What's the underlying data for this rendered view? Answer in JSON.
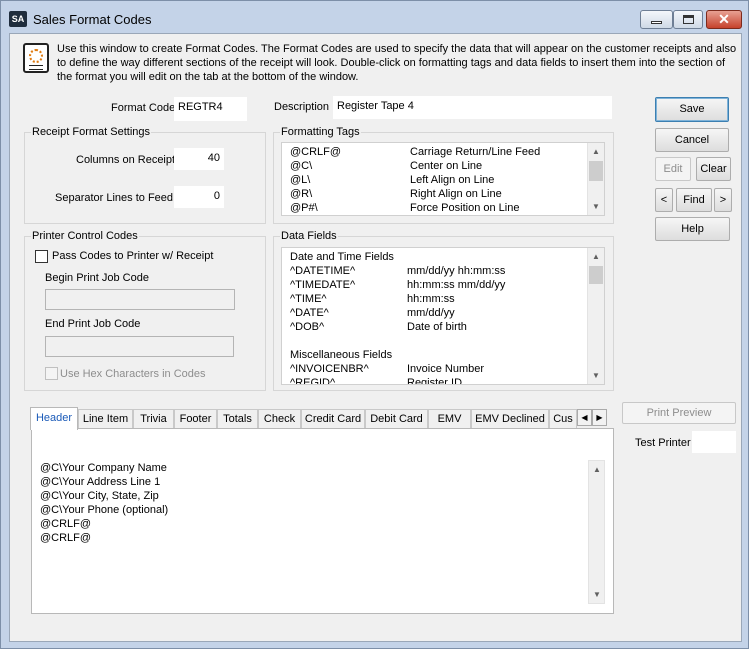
{
  "window": {
    "title": "Sales Format Codes",
    "app_badge": "SA"
  },
  "intro_text": "Use this window to create Format Codes.  The Format Codes are used to specify the data that will appear on the customer receipts and also to define the way different sections of the receipt will look.  Double-click on formatting tags and data fields to insert them into the section of the format you will edit on the tab at the bottom of the window.",
  "format_code": {
    "label": "Format Code",
    "value": "REGTR4"
  },
  "description": {
    "label": "Description",
    "value": "Register Tape 4"
  },
  "receipt_settings": {
    "title": "Receipt Format Settings",
    "columns_label": "Columns on Receipt",
    "columns_value": "40",
    "separator_label": "Separator Lines to Feed",
    "separator_value": "0"
  },
  "formatting_tags": {
    "title": "Formatting Tags",
    "rows": [
      {
        "tag": "@CRLF@",
        "desc": "Carriage Return/Line Feed"
      },
      {
        "tag": "@C\\",
        "desc": "Center on Line"
      },
      {
        "tag": "@L\\",
        "desc": "Left Align on Line"
      },
      {
        "tag": "@R\\",
        "desc": "Right Align on Line"
      },
      {
        "tag": "@P#\\",
        "desc": "Force Position on Line"
      }
    ]
  },
  "printer_codes": {
    "title": "Printer Control Codes",
    "pass_label": "Pass Codes to Printer w/ Receipt",
    "begin_label": "Begin Print Job Code",
    "begin_value": "",
    "end_label": "End Print Job Code",
    "end_value": "",
    "hex_label": "Use Hex Characters in Codes"
  },
  "data_fields": {
    "title": "Data Fields",
    "rows": [
      {
        "field": "Date and Time Fields",
        "desc": ""
      },
      {
        "field": "^DATETIME^",
        "desc": "mm/dd/yy hh:mm:ss"
      },
      {
        "field": "^TIMEDATE^",
        "desc": "hh:mm:ss mm/dd/yy"
      },
      {
        "field": "^TIME^",
        "desc": "hh:mm:ss"
      },
      {
        "field": "^DATE^",
        "desc": "mm/dd/yy"
      },
      {
        "field": "^DOB^",
        "desc": "Date of birth"
      },
      {
        "field": "",
        "desc": ""
      },
      {
        "field": "Miscellaneous Fields",
        "desc": ""
      },
      {
        "field": "^INVOICENBR^",
        "desc": "Invoice Number"
      },
      {
        "field": "^REGID^",
        "desc": "Register ID"
      }
    ]
  },
  "buttons": {
    "save": "Save",
    "cancel": "Cancel",
    "edit": "Edit",
    "clear": "Clear",
    "prev": "<",
    "find": "Find",
    "next": ">",
    "help": "Help",
    "print_preview": "Print Preview"
  },
  "test_printer": {
    "label": "Test Printer",
    "value": ""
  },
  "tabs": [
    "Header",
    "Line Item",
    "Trivia",
    "Footer",
    "Totals",
    "Check",
    "Credit Card",
    "Debit Card",
    "EMV",
    "EMV Declined",
    "Cus"
  ],
  "header_lines": [
    "@C\\Your Company Name",
    "@C\\Your Address Line 1",
    "@C\\Your City, State, Zip",
    "@C\\Your Phone (optional)",
    "@CRLF@",
    "@CRLF@"
  ]
}
